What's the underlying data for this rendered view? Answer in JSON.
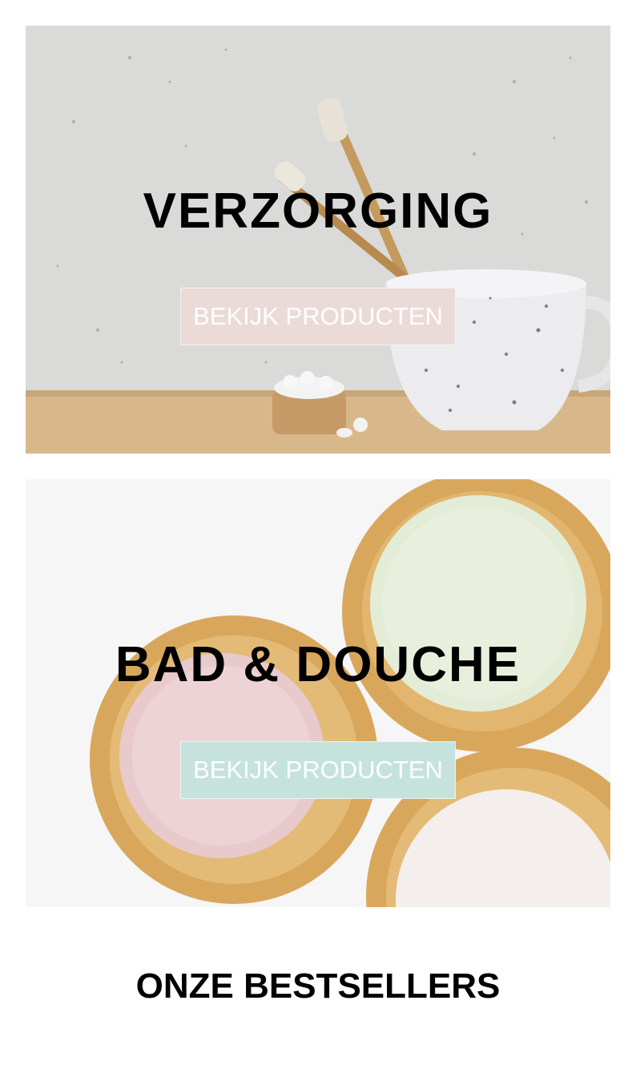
{
  "banners": [
    {
      "title": "VERZORGING",
      "button_label": "BEKIJK PRODUCTEN",
      "button_color": "#eadbd8"
    },
    {
      "title": "BAD & DOUCHE",
      "button_label": "BEKIJK PRODUCTEN",
      "button_color": "#c5e3dc"
    }
  ],
  "bestsellers": {
    "title": "ONZE BESTSELLERS"
  }
}
